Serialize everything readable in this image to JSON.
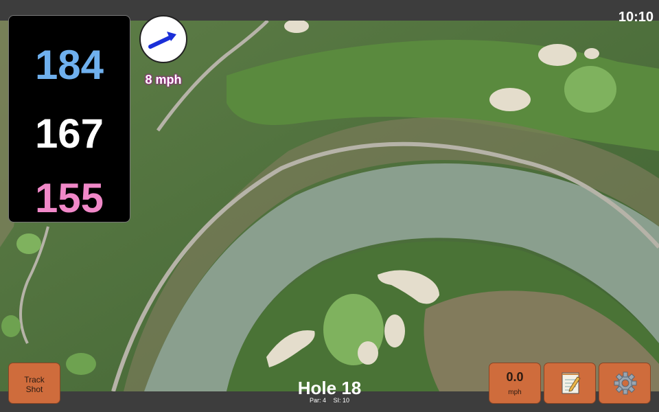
{
  "clock": "10:10",
  "distances": {
    "back": "184",
    "middle": "167",
    "front": "155",
    "back_color": "#6fb0ee",
    "front_color": "#f088c8"
  },
  "wind": {
    "speed": "8 mph",
    "arrow_color": "#1a2fd8",
    "icon": "wind-direction-arrow"
  },
  "buttons": {
    "track_shot_line1": "Track",
    "track_shot_line2": "Shot",
    "speed_value": "0.0",
    "speed_unit": "mph",
    "notes_icon": "notepad-icon",
    "settings_icon": "gear-icon"
  },
  "hole": {
    "title": "Hole 18",
    "par": "Par: 4",
    "si": "SI: 10"
  },
  "colors": {
    "button_orange": "#cf6c3c",
    "bar_gray": "#3d3d3d",
    "water": "#8a9f8e",
    "fairway": "#4f7a3a",
    "green": "#7fb25e",
    "sand": "#e4ddcc"
  }
}
